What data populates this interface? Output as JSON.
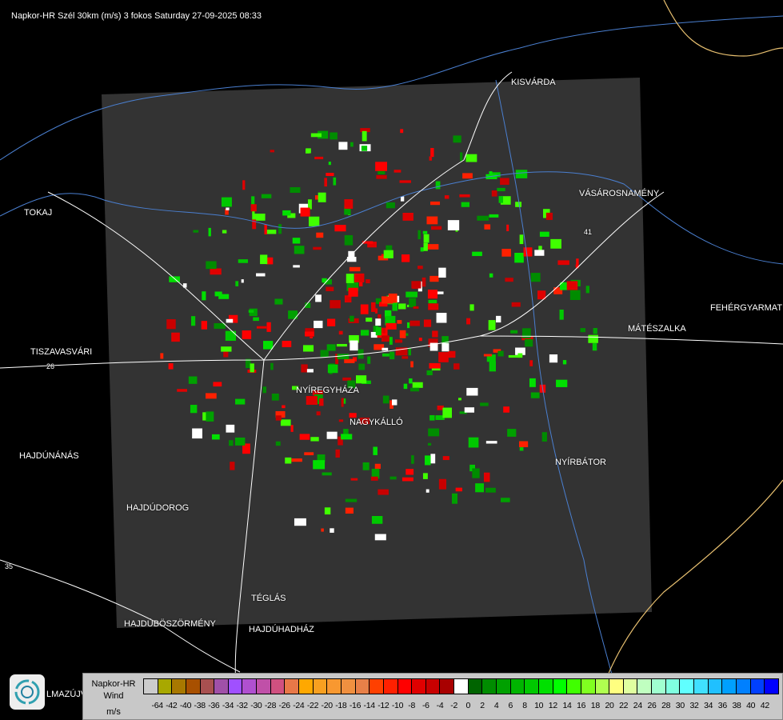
{
  "title": "Napkor-HR Szél 30km (m/s) 3 fokos Saturday 27-09-2025 08:33",
  "cities": [
    {
      "name": "KISVÁRDA"
    },
    {
      "name": "TOKAJ"
    },
    {
      "name": "VÁSÁROSNAMÉNY"
    },
    {
      "name": "FEHÉRGYARMAT"
    },
    {
      "name": "MÁTÉSZALKA"
    },
    {
      "name": "TISZAVASVÁRI"
    },
    {
      "name": "NYÍREGYHÁZA"
    },
    {
      "name": "NAGYKÁLLÓ"
    },
    {
      "name": "HAJDÚNÁNÁS"
    },
    {
      "name": "NYÍRBÁTOR"
    },
    {
      "name": "HAJDÚDOROG"
    },
    {
      "name": "TÉGLÁS"
    },
    {
      "name": "HAJDÚBÖSZÖRMÉNY"
    },
    {
      "name": "HAJDÚHADHÁZ"
    },
    {
      "name": "LMAZÚJVÁROS"
    }
  ],
  "road_numbers": [
    "26",
    "41",
    "35"
  ],
  "legend": {
    "title_line1": "Napkor-HR",
    "title_line2": "Wind",
    "unit": "m/s",
    "colors": [
      "#cccccc",
      "#a8a800",
      "#a87800",
      "#a85000",
      "#a85050",
      "#a050a8",
      "#a050ff",
      "#b050d0",
      "#c050a8",
      "#d05080",
      "#e87848",
      "#ffa800",
      "#f8a020",
      "#f89830",
      "#f09040",
      "#e88048",
      "#ff4000",
      "#ff2000",
      "#ff0000",
      "#e00000",
      "#c80000",
      "#a80000",
      "#ffffff",
      "#006400",
      "#008c00",
      "#00a000",
      "#00b400",
      "#00c800",
      "#00e000",
      "#00ff00",
      "#40ff00",
      "#80ff20",
      "#b0ff50",
      "#ffff80",
      "#e0ffa0",
      "#c0ffc0",
      "#a0ffd0",
      "#80ffe0",
      "#60ffff",
      "#40e0ff",
      "#20c0ff",
      "#00a0ff",
      "#0080ff",
      "#0040ff",
      "#0000ff"
    ],
    "labels": [
      "-64",
      "-42",
      "-40",
      "-38",
      "-36",
      "-34",
      "-32",
      "-30",
      "-28",
      "-26",
      "-24",
      "-22",
      "-20",
      "-18",
      "-16",
      "-14",
      "-12",
      "-10",
      "-8",
      "-6",
      "-4",
      "-2",
      "0",
      "2",
      "4",
      "6",
      "8",
      "10",
      "12",
      "14",
      "16",
      "18",
      "20",
      "22",
      "24",
      "26",
      "28",
      "30",
      "32",
      "34",
      "36",
      "38",
      "40",
      "42"
    ]
  }
}
